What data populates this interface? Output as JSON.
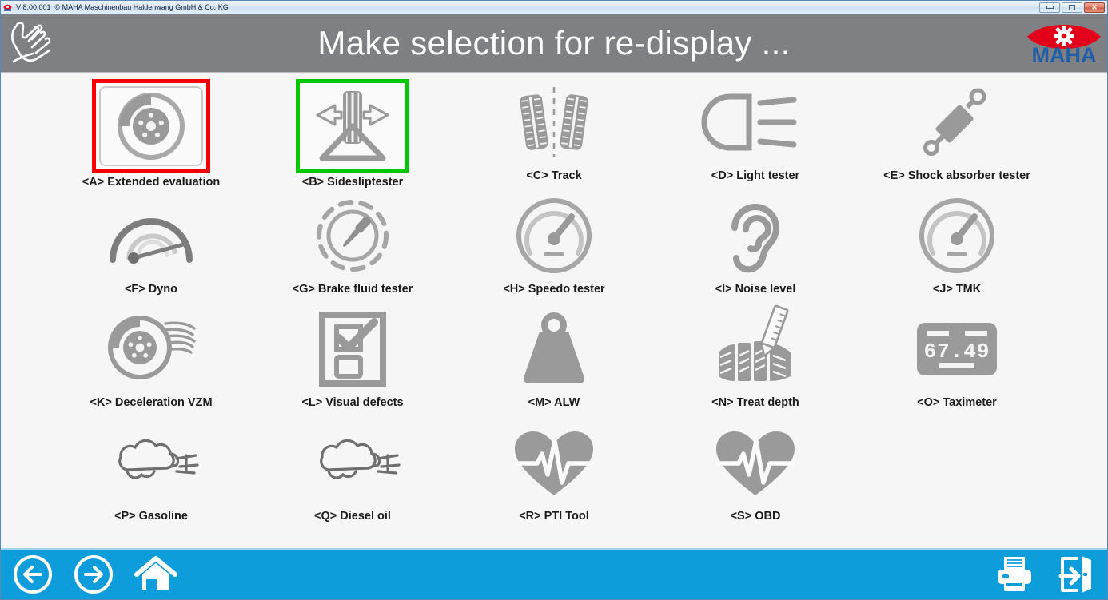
{
  "window": {
    "app_icon": "maha-app-icon",
    "version": "V 8.00.001",
    "copyright": "© MAHA Maschinenbau Haldenwang GmbH & Co. KG",
    "buttons": {
      "minimize": "minimize-button",
      "maximize": "maximize-button",
      "close_glyph": "✕"
    }
  },
  "header": {
    "title": "Make selection for re-display ...",
    "left_icon": "hands-clapping-icon",
    "logo_text": "MAHA",
    "logo_colors": {
      "red": "#e2001a",
      "blue": "#1f5fa9"
    },
    "background": "#7e8083"
  },
  "selection": {
    "red_border_color": "#f40000",
    "green_border_color": "#00c800",
    "selected_red": "A",
    "selected_green": "B"
  },
  "tiles": [
    {
      "key": "A",
      "label": "<A> Extended evaluation",
      "icon": "brake-disc-icon",
      "state": "selected-red"
    },
    {
      "key": "B",
      "label": "<B> Sidesliptester",
      "icon": "sideslip-tire-icon",
      "state": "selected-green"
    },
    {
      "key": "C",
      "label": "<C> Track",
      "icon": "track-tires-icon",
      "state": "normal"
    },
    {
      "key": "D",
      "label": "<D> Light tester",
      "icon": "headlight-icon",
      "state": "normal"
    },
    {
      "key": "E",
      "label": "<E> Shock absorber tester",
      "icon": "shock-absorber-icon",
      "state": "normal"
    },
    {
      "key": "F",
      "label": "<F> Dyno",
      "icon": "dyno-gauge-icon",
      "state": "normal"
    },
    {
      "key": "G",
      "label": "<G> Brake fluid tester",
      "icon": "pipette-circle-icon",
      "state": "normal"
    },
    {
      "key": "H",
      "label": "<H> Speedo tester",
      "icon": "speedometer-icon",
      "state": "normal"
    },
    {
      "key": "I",
      "label": "<I> Noise level",
      "icon": "ear-icon",
      "state": "normal"
    },
    {
      "key": "J",
      "label": "<J> TMK",
      "icon": "speedometer-icon",
      "state": "normal"
    },
    {
      "key": "K",
      "label": "<K> Deceleration VZM",
      "icon": "brake-disc-motion-icon",
      "state": "normal"
    },
    {
      "key": "L",
      "label": "<L> Visual defects",
      "icon": "checklist-icon",
      "state": "normal"
    },
    {
      "key": "M",
      "label": "<M> ALW",
      "icon": "weight-icon",
      "state": "normal"
    },
    {
      "key": "N",
      "label": "<N> Treat depth",
      "icon": "tread-depth-gauge-icon",
      "state": "normal"
    },
    {
      "key": "O",
      "label": "<O> Taximeter",
      "icon": "taximeter-display-icon",
      "state": "normal",
      "display_value": "67.49"
    },
    {
      "key": "P",
      "label": "<P> Gasoline",
      "icon": "exhaust-cloud-icon",
      "state": "normal"
    },
    {
      "key": "Q",
      "label": "<Q> Diesel oil",
      "icon": "exhaust-cloud-icon",
      "state": "normal"
    },
    {
      "key": "R",
      "label": "<R> PTI Tool",
      "icon": "heart-ecg-icon",
      "state": "normal"
    },
    {
      "key": "S",
      "label": "<S> OBD",
      "icon": "heart-ecg-icon",
      "state": "normal"
    }
  ],
  "footer": {
    "background": "#0e9ddb",
    "left_buttons": [
      {
        "name": "back-button",
        "icon": "arrow-left-circle-icon"
      },
      {
        "name": "forward-button",
        "icon": "arrow-right-circle-icon"
      },
      {
        "name": "home-button",
        "icon": "home-icon"
      }
    ],
    "right_buttons": [
      {
        "name": "print-button",
        "icon": "printer-icon"
      },
      {
        "name": "exit-button",
        "icon": "exit-door-icon"
      }
    ]
  }
}
